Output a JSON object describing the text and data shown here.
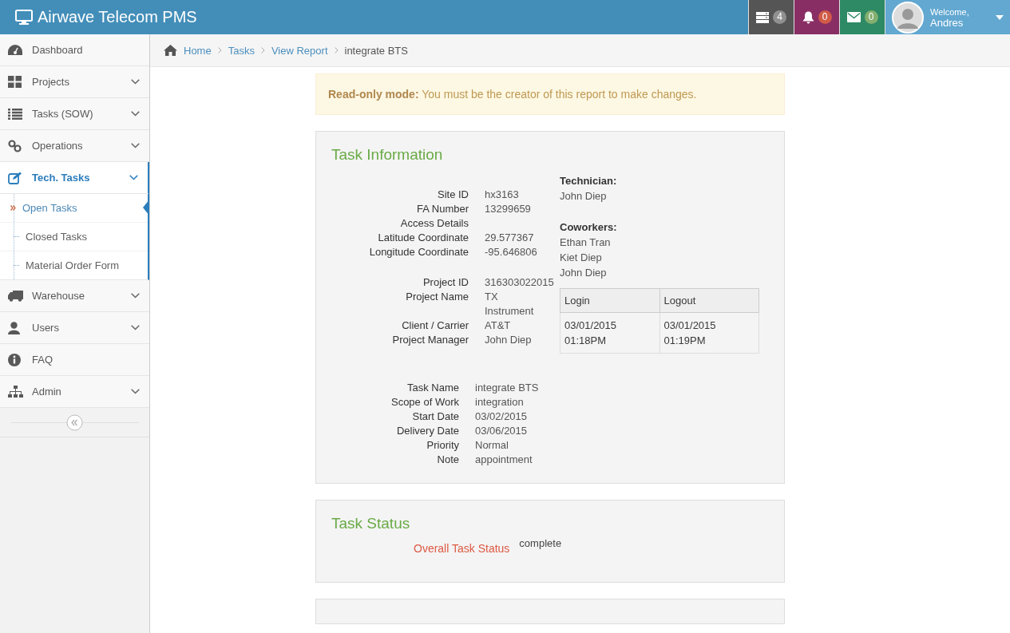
{
  "header": {
    "title": "Airwave Telecom PMS",
    "badges": [
      {
        "count": "4",
        "color": "#555555"
      },
      {
        "count": "0",
        "color": "#892e65"
      },
      {
        "count": "0",
        "color": "#2e8965"
      }
    ],
    "user": {
      "greeting": "Welcome,",
      "name": "Andres"
    }
  },
  "sidebar": {
    "items": [
      {
        "label": "Dashboard",
        "expandable": false,
        "selected": false
      },
      {
        "label": "Projects",
        "expandable": true,
        "selected": false
      },
      {
        "label": "Tasks (SOW)",
        "expandable": true,
        "selected": false
      },
      {
        "label": "Operations",
        "expandable": true,
        "selected": false
      },
      {
        "label": "Tech. Tasks",
        "expandable": true,
        "selected": true,
        "children": [
          {
            "label": "Open Tasks",
            "selected": true
          },
          {
            "label": "Closed Tasks",
            "selected": false
          },
          {
            "label": "Material Order Form",
            "selected": false
          }
        ]
      },
      {
        "label": "Warehouse",
        "expandable": true,
        "selected": false
      },
      {
        "label": "Users",
        "expandable": true,
        "selected": false
      },
      {
        "label": "FAQ",
        "expandable": false,
        "selected": false
      },
      {
        "label": "Admin",
        "expandable": true,
        "selected": false
      }
    ]
  },
  "breadcrumb": [
    "Home",
    "Tasks",
    "View Report",
    "integrate BTS"
  ],
  "alert": {
    "title": "Read-only mode:",
    "text": "You must be the creator of this report to make changes."
  },
  "task_information": {
    "title": "Task Information",
    "site_fields": [
      {
        "label": "Site ID",
        "value": "hx3163"
      },
      {
        "label": "FA Number",
        "value": "13299659"
      },
      {
        "label": "Access Details"
      },
      {
        "label": "Latitude Coordinate",
        "value": "29.577367"
      },
      {
        "label": "Longitude Coordinate",
        "value": "-95.646806"
      }
    ],
    "project_fields": [
      {
        "label": "Project ID",
        "value": "316303022015"
      },
      {
        "label": "Project Name",
        "value": "TX Instrument"
      },
      {
        "label": "Client / Carrier",
        "value": "AT&T"
      },
      {
        "label": "Project Manager",
        "value": "John Diep"
      }
    ],
    "technician_label": "Technician:",
    "technician": "John Diep",
    "coworkers_label": "Coworkers:",
    "coworkers": [
      "Ethan Tran",
      "Kiet Diep",
      "John Diep"
    ],
    "log_table": {
      "columns": [
        "Login",
        "Logout"
      ],
      "rows": [
        [
          "03/01/2015 01:18PM",
          "03/01/2015 01:19PM"
        ]
      ]
    },
    "task_fields": [
      {
        "label": "Task Name",
        "value": "integrate BTS"
      },
      {
        "label": "Scope of Work",
        "value": "integration"
      },
      {
        "label": "Start Date",
        "value": "03/02/2015"
      },
      {
        "label": "Delivery Date",
        "value": "03/06/2015"
      },
      {
        "label": "Priority",
        "value": "Normal"
      },
      {
        "label": "Note",
        "value": "appointment"
      }
    ]
  },
  "task_status": {
    "title": "Task Status",
    "label": "Overall Task Status",
    "value": "complete"
  }
}
